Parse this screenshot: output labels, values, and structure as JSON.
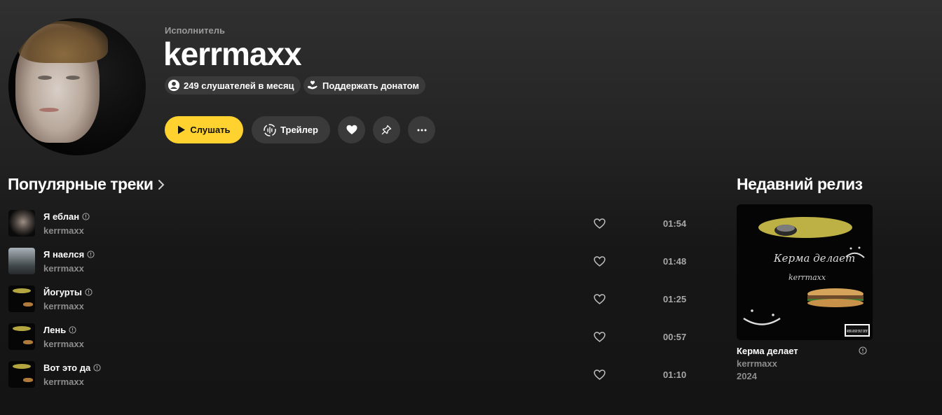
{
  "header": {
    "kicker": "Исполнитель",
    "artist_name": "kerrmaxx",
    "listeners_label": "249 слушателей в месяц",
    "donate_label": "Поддержать донатом",
    "icons": {
      "listeners": "user-circle-icon",
      "donate": "heart-hand-icon"
    }
  },
  "actions": {
    "play_label": "Слушать",
    "trailer_label": "Трейлер",
    "icons": [
      "play-icon",
      "trailer-wave-icon",
      "heart-icon",
      "pin-icon",
      "more-icon"
    ]
  },
  "colors": {
    "accent": "#ffd22f",
    "chip_bg": "#3a3a3a",
    "muted_text": "#8c8c8c"
  },
  "popular": {
    "title": "Популярные треки",
    "tracks": [
      {
        "title": "Я еблан",
        "artist": "kerrmaxx",
        "duration": "01:54"
      },
      {
        "title": "Я наелся",
        "artist": "kerrmaxx",
        "duration": "01:48"
      },
      {
        "title": "Йогурты",
        "artist": "kerrmaxx",
        "duration": "01:25"
      },
      {
        "title": "Лень",
        "artist": "kerrmaxx",
        "duration": "00:57"
      },
      {
        "title": "Вот это да",
        "artist": "kerrmaxx",
        "duration": "01:10"
      }
    ]
  },
  "recent": {
    "title": "Недавний релиз",
    "release": {
      "title": "Керма делает",
      "artist": "kerrmaxx",
      "year": "2024",
      "cover_text": "Керма делает",
      "cover_subtext": "kerrmaxx",
      "label_text": "PARENTAL ADVISORY EXPLICIT CONTENT"
    }
  }
}
